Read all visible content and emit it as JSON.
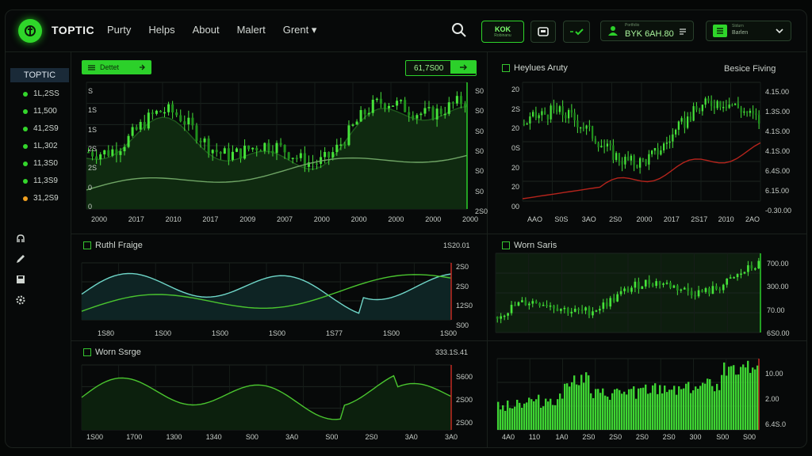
{
  "app": {
    "brand": "TOPTIC"
  },
  "nav": {
    "items": [
      "Purty",
      "Helps",
      "About",
      "Malert",
      "Grent ▾"
    ]
  },
  "toolbar": {
    "badge_main": "KOK",
    "badge_sub": "Robinanu",
    "price_label": "Portfolio",
    "price_value": "BYK 6AH.80",
    "account_label": "Stdurn",
    "account_value": "Barlen"
  },
  "sidebar": {
    "title": "TOPTIC",
    "tickers": [
      {
        "label": "1L,2SS",
        "color": "#34d62c"
      },
      {
        "label": "11,500",
        "color": "#34d62c"
      },
      {
        "label": "41,2S9",
        "color": "#34d62c"
      },
      {
        "label": "1L,302",
        "color": "#34d62c"
      },
      {
        "label": "11,3S0",
        "color": "#34d62c"
      },
      {
        "label": "11,3S9",
        "color": "#34d62c"
      },
      {
        "label": "31,2S9",
        "color": "#f0a020"
      }
    ],
    "icons": [
      "network-icon",
      "pencil-icon",
      "save-icon",
      "settings-icon"
    ]
  },
  "panels": {
    "main": {
      "tab_label": "Dettet",
      "value_label": "61,7S00",
      "y_left": [
        "S",
        "1S",
        "1S",
        "2S",
        "2S",
        "0",
        "0"
      ],
      "y_right": [
        "S0",
        "S0",
        "S0",
        "S0",
        "S0",
        "S0",
        "2S0"
      ],
      "x": [
        "2000",
        "2017",
        "2010",
        "2017",
        "2009",
        "2007",
        "2000",
        "2000",
        "2000",
        "2000",
        "2000"
      ]
    },
    "top_right": {
      "title": "Heylues Aruty",
      "subtitle": "Besice Fiving",
      "y_left": [
        "20",
        "2S",
        "20",
        "0S",
        "20",
        "20",
        "00"
      ],
      "y_right": [
        "4.15.00",
        "1.3S.00",
        "4.1S.00",
        "4.1S.00",
        "6.4S.00",
        "6.15.00",
        "-0.30.00"
      ],
      "x": [
        "AAO",
        "S0S",
        "3AO",
        "2S0",
        "2000",
        "2017",
        "2S17",
        "2010",
        "2AO"
      ]
    },
    "mid_left": {
      "title": "Ruthl Fraige",
      "value_label": "1S20.01",
      "y_right": [
        "2S0",
        "2S0",
        "12S0",
        "S00"
      ],
      "x": [
        "1S80",
        "1S00",
        "1S00",
        "1S00",
        "1S77",
        "1S00",
        "1S00"
      ]
    },
    "mid_right": {
      "title": "Worn Saris",
      "y_right": [
        "700.00",
        "300.00",
        "70.00",
        "6S0.00"
      ]
    },
    "bottom_left": {
      "title": "Worn Ssrge",
      "value_label": "333.1S.41",
      "y_right": [
        "S600",
        "2S00",
        "2S00"
      ],
      "x": [
        "1S00",
        "1700",
        "1300",
        "1340",
        "S00",
        "3A0",
        "S00",
        "2S0",
        "3A0",
        "3A0"
      ]
    },
    "bottom_right": {
      "y_right": [
        "10.00",
        "2.00",
        "6.4S.0"
      ],
      "x": [
        "4A0",
        "110",
        "1A0",
        "2S0",
        "2S0",
        "2S0",
        "2S0",
        "300",
        "S00",
        "S00"
      ]
    }
  }
}
